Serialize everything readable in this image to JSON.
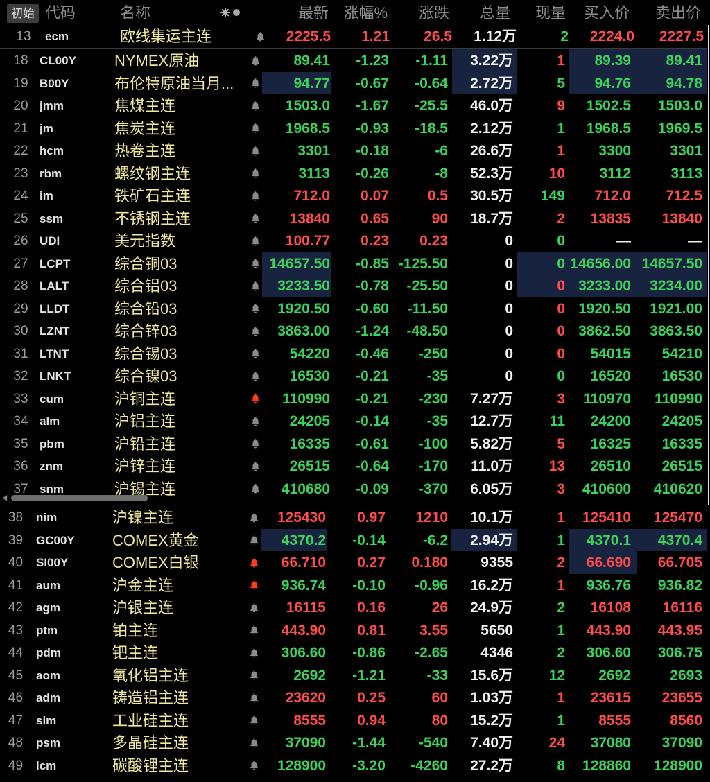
{
  "header": {
    "init_button": "初始",
    "code": "代码",
    "name": "名称",
    "last": "最新",
    "pct": "涨幅%",
    "chg": "涨跌",
    "vol": "总量",
    "cur": "现量",
    "bid": "买入价",
    "ask": "卖出价"
  },
  "icons": {
    "header_sort": "asterisk-icon",
    "header_mark": "circle-icon",
    "row_alert": "bell-icon",
    "scroll_left": "chevron-left-icon"
  },
  "palette": {
    "r": "#ff4d4d",
    "g": "#3cd35c",
    "w": "#f0f0f0",
    "flash": "#18233f",
    "alert": "#ff3b1f"
  },
  "pinned_row": {
    "idx": "13",
    "code": "ecm",
    "name": "欧线集运主连",
    "alert": false,
    "last": "2225.5",
    "pct": "1.21",
    "chg": "26.5",
    "vol": "1.12万",
    "cur": "2",
    "bid": "2224.0",
    "ask": "2227.5",
    "colors": "rrrwgrr"
  },
  "rows_upper": [
    {
      "idx": "18",
      "code": "CL00Y",
      "name": "NYMEX原油",
      "alert": false,
      "last": "89.41",
      "pct": "-1.23",
      "chg": "-1.11",
      "vol": "3.22万",
      "cur": "1",
      "bid": "89.39",
      "ask": "89.41",
      "colors": "gggwrgg",
      "flash": [
        "vol",
        "bid",
        "ask"
      ]
    },
    {
      "idx": "19",
      "code": "B00Y",
      "name": "布伦特原油当月...",
      "alert": false,
      "last": "94.77",
      "pct": "-0.67",
      "chg": "-0.64",
      "vol": "2.72万",
      "cur": "5",
      "bid": "94.76",
      "ask": "94.78",
      "colors": "gggwggg",
      "flash": [
        "last",
        "vol",
        "bid",
        "ask"
      ]
    },
    {
      "idx": "20",
      "code": "jmm",
      "name": "焦煤主连",
      "alert": false,
      "last": "1503.0",
      "pct": "-1.67",
      "chg": "-25.5",
      "vol": "46.0万",
      "cur": "9",
      "bid": "1502.5",
      "ask": "1503.0",
      "colors": "gggwrgg"
    },
    {
      "idx": "21",
      "code": "jm",
      "name": "焦炭主连",
      "alert": false,
      "last": "1968.5",
      "pct": "-0.93",
      "chg": "-18.5",
      "vol": "2.12万",
      "cur": "1",
      "bid": "1968.5",
      "ask": "1969.5",
      "colors": "gggwggg"
    },
    {
      "idx": "22",
      "code": "hcm",
      "name": "热卷主连",
      "alert": false,
      "last": "3301",
      "pct": "-0.18",
      "chg": "-6",
      "vol": "26.6万",
      "cur": "1",
      "bid": "3300",
      "ask": "3301",
      "colors": "gggwrgg"
    },
    {
      "idx": "23",
      "code": "rbm",
      "name": "螺纹钢主连",
      "alert": false,
      "last": "3113",
      "pct": "-0.26",
      "chg": "-8",
      "vol": "52.3万",
      "cur": "10",
      "bid": "3112",
      "ask": "3113",
      "colors": "gggwrgg"
    },
    {
      "idx": "24",
      "code": "im",
      "name": "铁矿石主连",
      "alert": false,
      "last": "712.0",
      "pct": "0.07",
      "chg": "0.5",
      "vol": "30.5万",
      "cur": "149",
      "bid": "712.0",
      "ask": "712.5",
      "colors": "rrrwgrr"
    },
    {
      "idx": "25",
      "code": "ssm",
      "name": "不锈钢主连",
      "alert": false,
      "last": "13840",
      "pct": "0.65",
      "chg": "90",
      "vol": "18.7万",
      "cur": "2",
      "bid": "13835",
      "ask": "13840",
      "colors": "rrrwrrr"
    },
    {
      "idx": "26",
      "code": "UDI",
      "name": "美元指数",
      "alert": false,
      "last": "100.77",
      "pct": "0.23",
      "chg": "0.23",
      "vol": "0",
      "cur": "0",
      "bid": "—",
      "ask": "—",
      "colors": "rrrwgww"
    },
    {
      "idx": "27",
      "code": "LCPT",
      "name": "综合铜03",
      "alert": false,
      "last": "14657.50",
      "pct": "-0.85",
      "chg": "-125.50",
      "vol": "0",
      "cur": "0",
      "bid": "14656.00",
      "ask": "14657.50",
      "colors": "gggwggg",
      "flash": [
        "last",
        "cur",
        "bid",
        "ask"
      ]
    },
    {
      "idx": "28",
      "code": "LALT",
      "name": "综合铝03",
      "alert": false,
      "last": "3233.50",
      "pct": "-0.78",
      "chg": "-25.50",
      "vol": "0",
      "cur": "0",
      "bid": "3233.00",
      "ask": "3234.00",
      "colors": "gggwrgg",
      "flash": [
        "last",
        "cur",
        "bid",
        "ask"
      ]
    },
    {
      "idx": "29",
      "code": "LLDT",
      "name": "综合铅03",
      "alert": false,
      "last": "1920.50",
      "pct": "-0.60",
      "chg": "-11.50",
      "vol": "0",
      "cur": "0",
      "bid": "1920.50",
      "ask": "1921.00",
      "colors": "gggwrgg"
    },
    {
      "idx": "30",
      "code": "LZNT",
      "name": "综合锌03",
      "alert": false,
      "last": "3863.00",
      "pct": "-1.24",
      "chg": "-48.50",
      "vol": "0",
      "cur": "0",
      "bid": "3862.50",
      "ask": "3863.50",
      "colors": "gggwrgg"
    },
    {
      "idx": "31",
      "code": "LTNT",
      "name": "综合锡03",
      "alert": false,
      "last": "54220",
      "pct": "-0.46",
      "chg": "-250",
      "vol": "0",
      "cur": "0",
      "bid": "54015",
      "ask": "54210",
      "colors": "gggwrgg"
    },
    {
      "idx": "32",
      "code": "LNKT",
      "name": "综合镍03",
      "alert": false,
      "last": "16530",
      "pct": "-0.21",
      "chg": "-35",
      "vol": "0",
      "cur": "0",
      "bid": "16520",
      "ask": "16530",
      "colors": "gggwggg"
    },
    {
      "idx": "33",
      "code": "cum",
      "name": "沪铜主连",
      "alert": true,
      "last": "110990",
      "pct": "-0.21",
      "chg": "-230",
      "vol": "7.27万",
      "cur": "3",
      "bid": "110970",
      "ask": "110990",
      "colors": "gggwrgg"
    },
    {
      "idx": "34",
      "code": "alm",
      "name": "沪铝主连",
      "alert": false,
      "last": "24205",
      "pct": "-0.14",
      "chg": "-35",
      "vol": "12.7万",
      "cur": "11",
      "bid": "24200",
      "ask": "24205",
      "colors": "gggwggg"
    },
    {
      "idx": "35",
      "code": "pbm",
      "name": "沪铅主连",
      "alert": false,
      "last": "16335",
      "pct": "-0.61",
      "chg": "-100",
      "vol": "5.82万",
      "cur": "5",
      "bid": "16325",
      "ask": "16335",
      "colors": "gggwrgg"
    },
    {
      "idx": "36",
      "code": "znm",
      "name": "沪锌主连",
      "alert": false,
      "last": "26515",
      "pct": "-0.64",
      "chg": "-170",
      "vol": "11.0万",
      "cur": "13",
      "bid": "26510",
      "ask": "26515",
      "colors": "gggwrgg"
    },
    {
      "idx": "37",
      "code": "snm",
      "name": "沪锡主连",
      "alert": false,
      "last": "410680",
      "pct": "-0.09",
      "chg": "-370",
      "vol": "6.05万",
      "cur": "3",
      "bid": "410600",
      "ask": "410620",
      "colors": "gggwrgg"
    }
  ],
  "rows_lower": [
    {
      "idx": "38",
      "code": "nim",
      "name": "沪镍主连",
      "alert": false,
      "last": "125430",
      "pct": "0.97",
      "chg": "1210",
      "vol": "10.1万",
      "cur": "1",
      "bid": "125410",
      "ask": "125470",
      "colors": "rrrwrrr"
    },
    {
      "idx": "39",
      "code": "GC00Y",
      "name": "COMEX黄金",
      "alert": false,
      "last": "4370.2",
      "pct": "-0.14",
      "chg": "-6.2",
      "vol": "2.94万",
      "cur": "1",
      "bid": "4370.1",
      "ask": "4370.4",
      "colors": "gggwggg",
      "flash": [
        "last",
        "vol",
        "bid",
        "ask"
      ]
    },
    {
      "idx": "40",
      "code": "SI00Y",
      "name": "COMEX白银",
      "alert": true,
      "last": "66.710",
      "pct": "0.27",
      "chg": "0.180",
      "vol": "9355",
      "cur": "2",
      "bid": "66.690",
      "ask": "66.705",
      "colors": "rrrwrrr",
      "flash": [
        "bid"
      ]
    },
    {
      "idx": "41",
      "code": "aum",
      "name": "沪金主连",
      "alert": true,
      "last": "936.74",
      "pct": "-0.10",
      "chg": "-0.96",
      "vol": "16.2万",
      "cur": "1",
      "bid": "936.76",
      "ask": "936.82",
      "colors": "gggwrgg"
    },
    {
      "idx": "42",
      "code": "agm",
      "name": "沪银主连",
      "alert": false,
      "last": "16115",
      "pct": "0.16",
      "chg": "26",
      "vol": "24.9万",
      "cur": "2",
      "bid": "16108",
      "ask": "16116",
      "colors": "rrrwgrr"
    },
    {
      "idx": "43",
      "code": "ptm",
      "name": "铂主连",
      "alert": false,
      "last": "443.90",
      "pct": "0.81",
      "chg": "3.55",
      "vol": "5650",
      "cur": "1",
      "bid": "443.90",
      "ask": "443.95",
      "colors": "rrrwgrr"
    },
    {
      "idx": "44",
      "code": "pdm",
      "name": "钯主连",
      "alert": false,
      "last": "306.60",
      "pct": "-0.86",
      "chg": "-2.65",
      "vol": "4346",
      "cur": "2",
      "bid": "306.60",
      "ask": "306.75",
      "colors": "gggwggg"
    },
    {
      "idx": "45",
      "code": "aom",
      "name": "氧化铝主连",
      "alert": false,
      "last": "2692",
      "pct": "-1.21",
      "chg": "-33",
      "vol": "15.6万",
      "cur": "12",
      "bid": "2692",
      "ask": "2693",
      "colors": "gggwggg"
    },
    {
      "idx": "46",
      "code": "adm",
      "name": "铸造铝主连",
      "alert": false,
      "last": "23620",
      "pct": "0.25",
      "chg": "60",
      "vol": "1.03万",
      "cur": "1",
      "bid": "23615",
      "ask": "23655",
      "colors": "rrrwrrr"
    },
    {
      "idx": "47",
      "code": "sim",
      "name": "工业硅主连",
      "alert": false,
      "last": "8555",
      "pct": "0.94",
      "chg": "80",
      "vol": "15.2万",
      "cur": "1",
      "bid": "8555",
      "ask": "8560",
      "colors": "rrrwgrr"
    },
    {
      "idx": "48",
      "code": "psm",
      "name": "多晶硅主连",
      "alert": false,
      "last": "37090",
      "pct": "-1.44",
      "chg": "-540",
      "vol": "7.40万",
      "cur": "24",
      "bid": "37080",
      "ask": "37090",
      "colors": "gggwrgg"
    },
    {
      "idx": "49",
      "code": "lcm",
      "name": "碳酸锂主连",
      "alert": false,
      "last": "128900",
      "pct": "-3.20",
      "chg": "-4260",
      "vol": "27.2万",
      "cur": "8",
      "bid": "128860",
      "ask": "128900",
      "colors": "gggwggg"
    }
  ]
}
